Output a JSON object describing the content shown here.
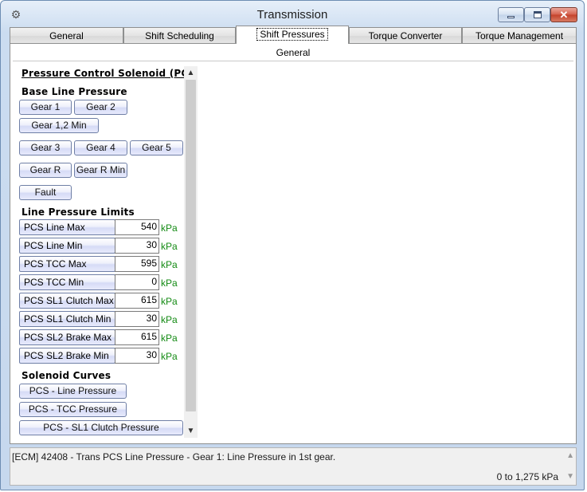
{
  "window": {
    "title": "Transmission"
  },
  "tabs": [
    "General",
    "Shift Scheduling",
    "Shift Pressures",
    "Torque Converter",
    "Torque Management"
  ],
  "active_tab": "Shift Pressures",
  "subtab": "General",
  "panel": {
    "header": "Pressure Control Solenoid (PCS",
    "base_line_pressure": {
      "title": "Base Line Pressure",
      "buttons": [
        "Gear 1",
        "Gear 2",
        "Gear 1,2 Min",
        "Gear 3",
        "Gear 4",
        "Gear 5",
        "Gear R",
        "Gear R Min",
        "Fault"
      ]
    },
    "line_pressure_limits": {
      "title": "Line Pressure Limits",
      "fields": [
        {
          "label": "PCS Line Max",
          "value": "540",
          "unit": "kPa"
        },
        {
          "label": "PCS Line Min",
          "value": "30",
          "unit": "kPa"
        },
        {
          "label": "PCS TCC Max",
          "value": "595",
          "unit": "kPa"
        },
        {
          "label": "PCS TCC Min",
          "value": "0",
          "unit": "kPa"
        },
        {
          "label": "PCS SL1 Clutch Max",
          "value": "615",
          "unit": "kPa"
        },
        {
          "label": "PCS SL1 Clutch Min",
          "value": "30",
          "unit": "kPa"
        },
        {
          "label": "PCS SL2 Brake Max",
          "value": "615",
          "unit": "kPa"
        },
        {
          "label": "PCS SL2 Brake Min",
          "value": "30",
          "unit": "kPa"
        }
      ]
    },
    "solenoid_curves": {
      "title": "Solenoid Curves",
      "buttons": [
        "PCS - Line Pressure",
        "PCS - TCC Pressure",
        "PCS - SL1 Clutch Pressure"
      ]
    }
  },
  "status": {
    "message": "[ECM] 42408 - Trans PCS Line Pressure - Gear 1: Line Pressure in 1st gear.",
    "range": "0 to 1,275 kPa"
  },
  "icons": {
    "window": "gear-icon",
    "minimize": "minimize-icon",
    "maximize": "maximize-icon",
    "close": "close-icon"
  }
}
